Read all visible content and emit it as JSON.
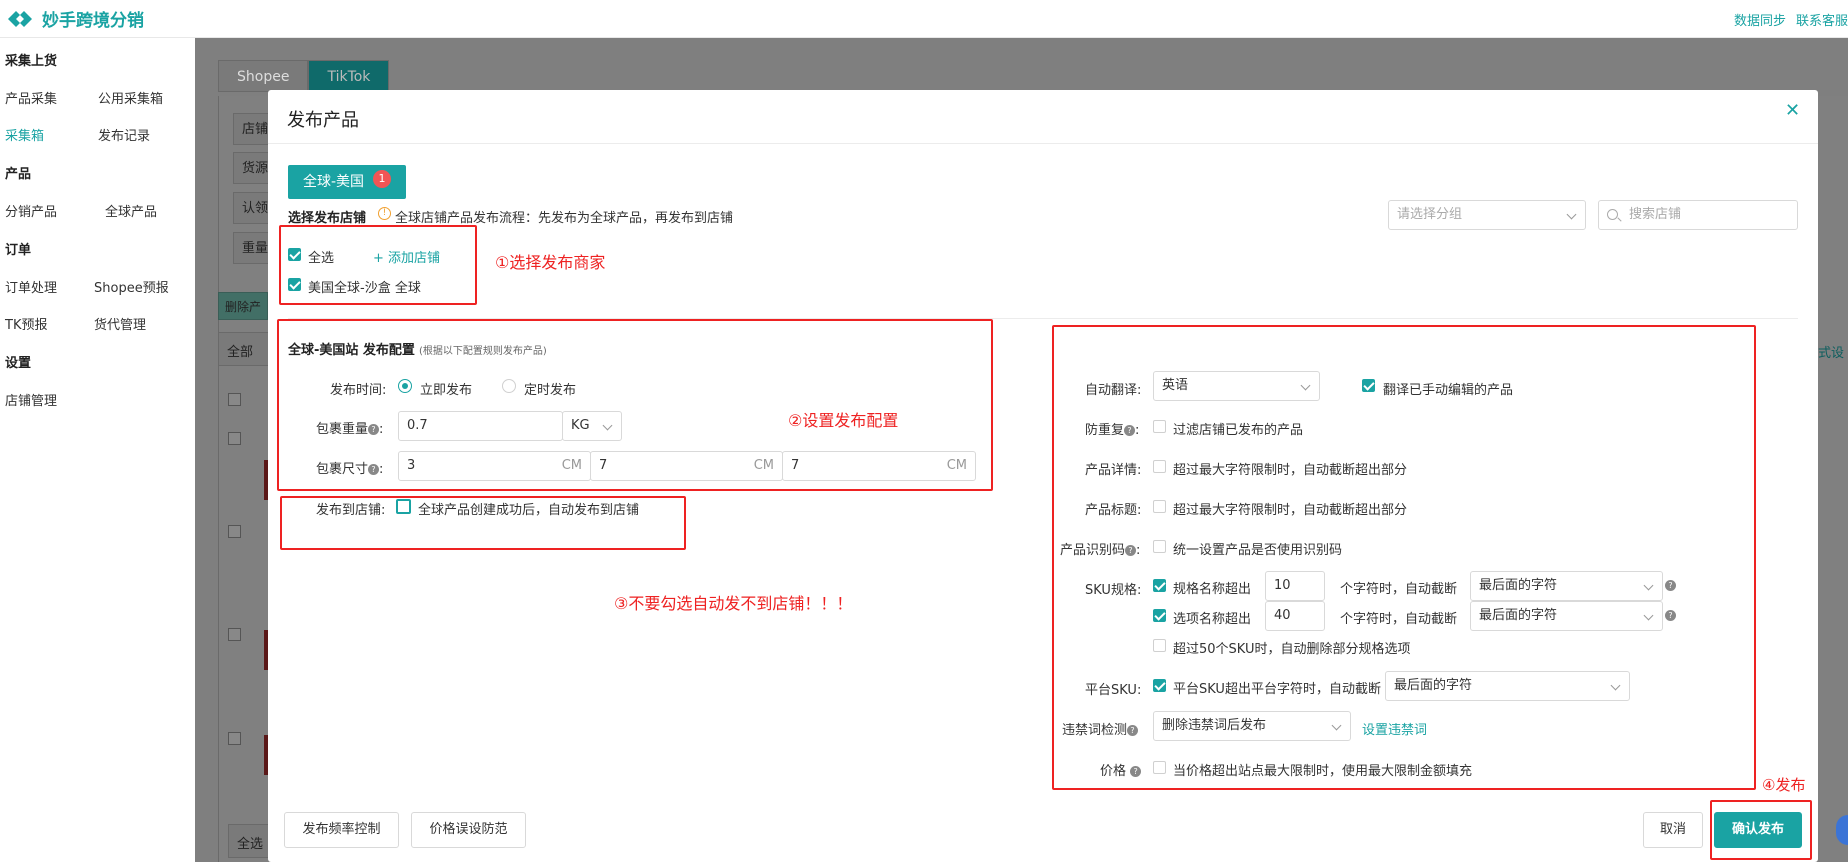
{
  "app": {
    "name": "妙手跨境分销"
  },
  "topbar": {
    "links": [
      "数据同步",
      "联系客服"
    ]
  },
  "sidebar": {
    "groups": [
      {
        "title": "采集上货",
        "items": [
          "产品采集",
          "公用采集箱",
          "采集箱",
          "发布记录"
        ]
      },
      {
        "title": "产品",
        "items": [
          "分销产品",
          "全球产品"
        ]
      },
      {
        "title": "订单",
        "items": [
          "订单处理",
          "Shopee预报",
          "TK预报",
          "货代管理"
        ]
      },
      {
        "title": "设置",
        "items": [
          "店铺管理"
        ]
      }
    ],
    "active_item": "采集箱"
  },
  "background": {
    "tabs": [
      "Shopee",
      "TikTok"
    ],
    "field_labels": [
      "店铺",
      "货源",
      "认领",
      "重量"
    ],
    "delete_btn": "删除产",
    "all_btn": "全部",
    "select_all": "全选",
    "right_link": "式设"
  },
  "modal": {
    "title": "发布产品",
    "region_tab": "全球-美国",
    "region_badge": "1",
    "select_store_label": "选择发布店铺",
    "flow_hint": "全球店铺产品发布流程：先发布为全球产品，再发布到店铺",
    "group_select_placeholder": "请选择分组",
    "search_store_placeholder": "搜索店铺",
    "select_all_label": "全选",
    "add_store_label": "添加店铺",
    "store_item_label": "美国全球-沙盒 全球",
    "config_title": "全球-美国站 发布配置",
    "config_note": "(根据以下配置规则发布产品)",
    "publish_time": {
      "label": "发布时间:",
      "options": [
        "立即发布",
        "定时发布"
      ],
      "selected": "立即发布"
    },
    "weight": {
      "label": "包裹重量",
      "value": "0.7",
      "unit": "KG"
    },
    "size": {
      "label": "包裹尺寸",
      "values": [
        "3",
        "7",
        "7"
      ],
      "unit": "CM"
    },
    "publish_to_store": {
      "label": "发布到店铺:",
      "text": "全球产品创建成功后，自动发布到店铺",
      "checked": false
    },
    "right": {
      "auto_translate": {
        "label": "自动翻译:",
        "value": "英语",
        "check_text": "翻译已手动编辑的产品",
        "checked": true
      },
      "dedupe": {
        "label": "防重复",
        "text": "过滤店铺已发布的产品"
      },
      "detail": {
        "label": "产品详情:",
        "text": "超过最大字符限制时，自动截断超出部分"
      },
      "title": {
        "label": "产品标题:",
        "text": "超过最大字符限制时，自动截断超出部分"
      },
      "identifier": {
        "label": "产品识别码",
        "text": "统一设置产品是否使用识别码"
      },
      "sku_spec": {
        "label": "SKU规格:",
        "row1": {
          "text": "规格名称超出",
          "value": "10",
          "suffix": "个字符时，自动截断",
          "select": "最后面的字符"
        },
        "row2": {
          "text": "选项名称超出",
          "value": "40",
          "suffix": "个字符时，自动截断",
          "select": "最后面的字符"
        },
        "row3": {
          "text": "超过50个SKU时，自动删除部分规格选项"
        }
      },
      "platform_sku": {
        "label": "平台SKU:",
        "text": "平台SKU超出平台字符时，自动截断",
        "select": "最后面的字符"
      },
      "forbidden": {
        "label": "违禁词检测",
        "select": "删除违禁词后发布",
        "link": "设置违禁词"
      },
      "price": {
        "label": "价格",
        "text": "当价格超出站点最大限制时，使用最大限制金额填充"
      }
    },
    "footer": {
      "left_buttons": [
        "发布频率控制",
        "价格误设防范"
      ],
      "cancel": "取消",
      "confirm": "确认发布"
    }
  },
  "annotations": {
    "step1": "①选择发布商家",
    "step2": "②设置发布配置",
    "step3": "③不要勾选自动发不到店铺！！！",
    "step4": "④发布"
  },
  "colors": {
    "accent": "#1aa3a3",
    "annotation": "#ee2222"
  }
}
